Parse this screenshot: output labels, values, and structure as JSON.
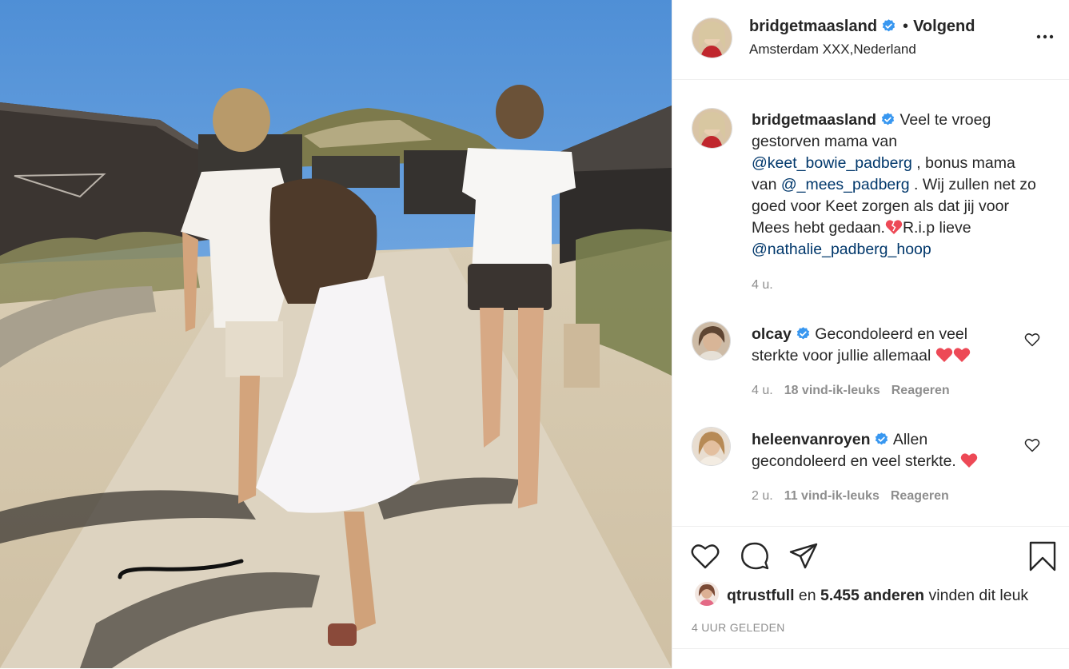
{
  "post": {
    "author": "bridgetmaasland",
    "follow_separator": "•",
    "follow_label": "Volgend",
    "location": "Amsterdam XXX,Nederland",
    "more_icon": "more-horizontal-icon"
  },
  "caption": {
    "author": "bridgetmaasland",
    "text1": "Veel te vroeg gestorven mama van ",
    "mention1": "@keet_bowie_padberg",
    "text2": " , bonus mama van ",
    "mention2": "@_mees_padberg",
    "text3": " . Wij zullen net zo goed voor Keet zorgen als dat jij voor Mees hebt gedaan.",
    "text4": "R.i.p lieve ",
    "mention3": "@nathalie_padberg_hoop",
    "time": "4 u."
  },
  "comments": [
    {
      "user": "olcay",
      "text": "Gecondoleerd en veel sterkte voor jullie allemaal ",
      "time": "4 u.",
      "likes": "18 vind-ik-leuks",
      "reply": "Reageren"
    },
    {
      "user": "heleenvanroyen",
      "text": "Allen gecondoleerd en veel sterkte. ",
      "time": "2 u.",
      "likes": "11 vind-ik-leuks",
      "reply": "Reageren"
    }
  ],
  "likes": {
    "first_liker": "qtrustfull",
    "connector": " en ",
    "others": "5.455 anderen",
    "suffix": " vinden dit leuk"
  },
  "timestamp": "4 UUR GELEDEN",
  "colors": {
    "verified_blue": "#3897f0",
    "mention_blue": "#00376b",
    "heart_red": "#ed4956",
    "meta_grey": "#8e8e8e"
  }
}
